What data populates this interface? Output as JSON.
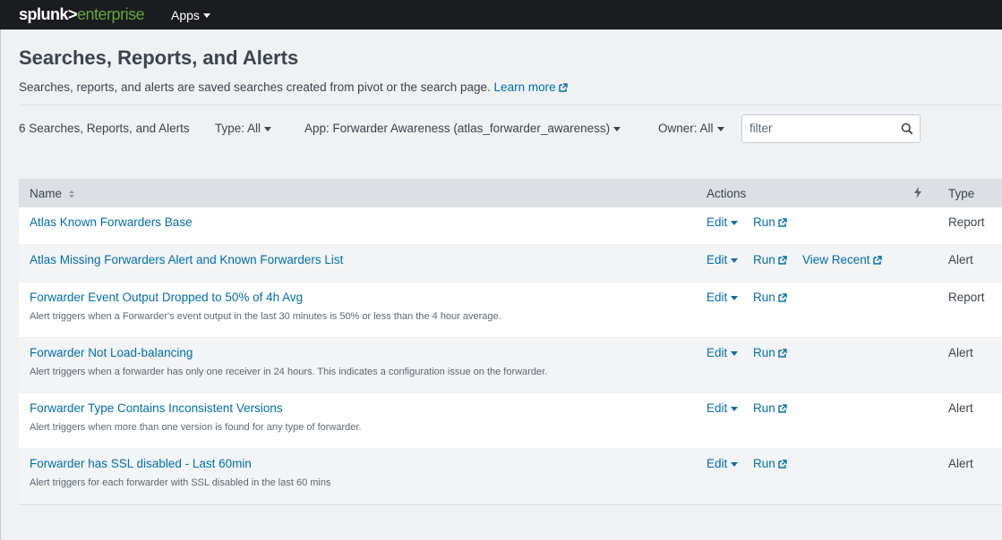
{
  "topbar": {
    "logo_part1": "splunk>",
    "logo_part2": "enterprise",
    "apps_label": "Apps"
  },
  "page": {
    "title": "Searches, Reports, and Alerts",
    "description": "Searches, reports, and alerts are saved searches created from pivot or the search page.",
    "learn_more": "Learn more"
  },
  "filters": {
    "count_label": "6 Searches, Reports, and Alerts",
    "type": "Type: All",
    "app": "App: Forwarder Awareness (atlas_forwarder_awareness)",
    "owner": "Owner: All",
    "search_placeholder": "filter"
  },
  "table": {
    "headers": {
      "name": "Name",
      "actions": "Actions",
      "type": "Type"
    },
    "edit_label": "Edit",
    "run_label": "Run",
    "view_recent_label": "View Recent",
    "rows": [
      {
        "name": "Atlas Known Forwarders Base",
        "description": "",
        "type": "Report"
      },
      {
        "name": "Atlas Missing Forwarders Alert and Known Forwarders List",
        "description": "",
        "type": "Alert"
      },
      {
        "name": "Forwarder Event Output Dropped to 50% of 4h Avg",
        "description": "Alert triggers when a Forwarder's event output in the last 30 minutes is 50% or less than the 4 hour average.",
        "type": "Report"
      },
      {
        "name": "Forwarder Not Load-balancing",
        "description": "Alert triggers when a forwarder has only one receiver in 24 hours. This indicates a configuration issue on the forwarder.",
        "type": "Alert"
      },
      {
        "name": "Forwarder Type Contains Inconsistent Versions",
        "description": "Alert triggers when more than one version is found for any type of forwarder.",
        "type": "Alert"
      },
      {
        "name": "Forwarder has SSL disabled - Last 60min",
        "description": "Alert triggers for each forwarder with SSL disabled in the last 60 mins",
        "type": "Alert"
      }
    ]
  },
  "colors": {
    "topbar_bg": "#1a1c20",
    "logo_accent": "#65a637",
    "link": "#006eaa",
    "page_bg": "#eff1f3"
  }
}
